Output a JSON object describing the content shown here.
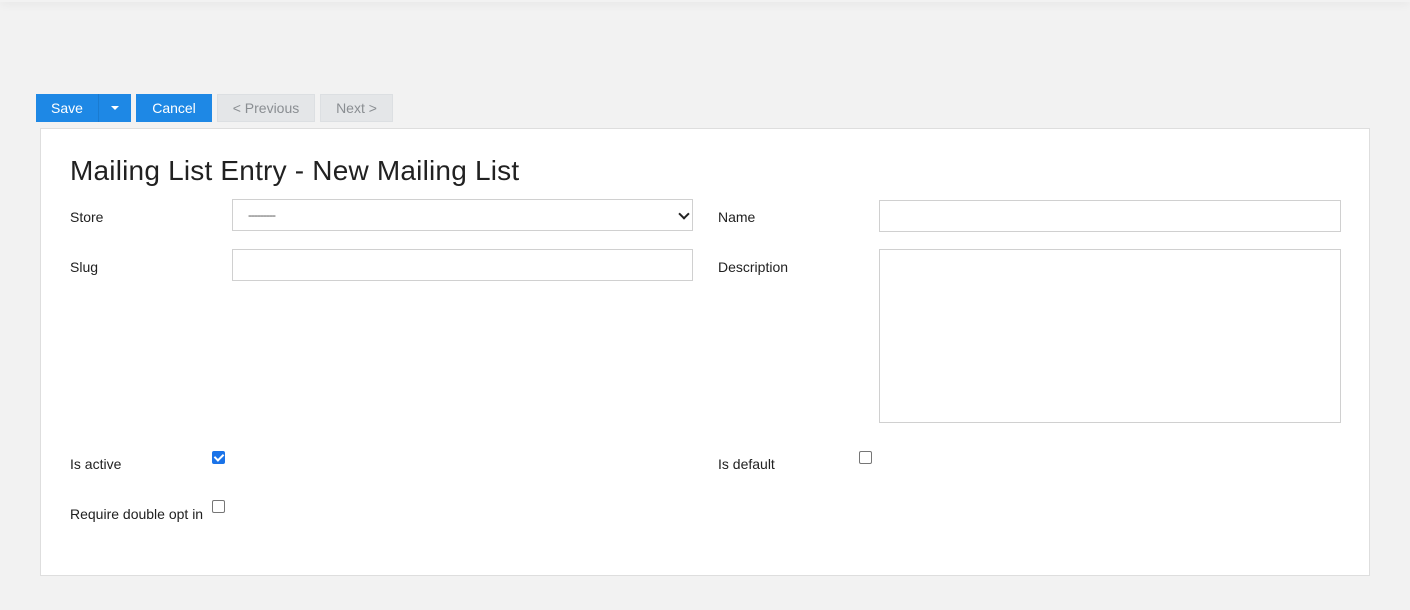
{
  "toolbar": {
    "save_label": "Save",
    "cancel_label": "Cancel",
    "previous_label": "< Previous",
    "next_label": "Next >"
  },
  "form": {
    "title": "Mailing List Entry - New Mailing List",
    "store": {
      "label": "Store",
      "selected_value": "---------"
    },
    "name": {
      "label": "Name",
      "value": ""
    },
    "slug": {
      "label": "Slug",
      "value": ""
    },
    "description": {
      "label": "Description",
      "value": ""
    },
    "is_active": {
      "label": "Is active",
      "checked": true
    },
    "is_default": {
      "label": "Is default",
      "checked": false
    },
    "require_double_opt_in": {
      "label": "Require double opt in",
      "checked": false
    }
  },
  "colors": {
    "primary": "#1e88e5",
    "background": "#f2f2f2",
    "panel": "#ffffff",
    "disabled_button": "#e4e6e8"
  }
}
